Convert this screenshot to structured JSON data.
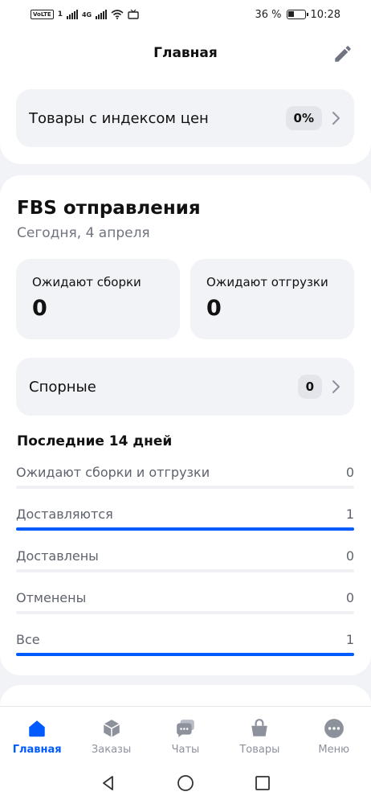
{
  "status_bar": {
    "carrier_badge": "VoLTE",
    "sim_slot": "1",
    "network": "4G",
    "battery_percent": "36 %",
    "time": "10:28"
  },
  "header": {
    "title": "Главная",
    "edit_icon": "pencil-icon",
    "price_index": {
      "label": "Товары с индексом цен",
      "value": "0%"
    }
  },
  "fbs": {
    "title": "FBS отправления",
    "date": "Сегодня, 4 апреля",
    "awaiting_assembly": {
      "label": "Ожидают сборки",
      "value": "0"
    },
    "awaiting_shipment": {
      "label": "Ожидают отгрузки",
      "value": "0"
    },
    "disputed": {
      "label": "Спорные",
      "value": "0"
    },
    "period_title": "Последние 14 дней",
    "period_items": [
      {
        "label": "Ожидают сборки и отгрузки",
        "value": "0",
        "progress": 0
      },
      {
        "label": "Доставляются",
        "value": "1",
        "progress": 1
      },
      {
        "label": "Доставлены",
        "value": "0",
        "progress": 0
      },
      {
        "label": "Отменены",
        "value": "0",
        "progress": 0
      },
      {
        "label": "Все",
        "value": "1",
        "progress": 1
      }
    ]
  },
  "bottom_nav": {
    "items": [
      {
        "label": "Главная",
        "icon": "home-icon",
        "active": true
      },
      {
        "label": "Заказы",
        "icon": "box-icon",
        "active": false
      },
      {
        "label": "Чаты",
        "icon": "chat-icon",
        "active": false
      },
      {
        "label": "Товары",
        "icon": "basket-icon",
        "active": false
      },
      {
        "label": "Меню",
        "icon": "more-icon",
        "active": false
      }
    ]
  },
  "colors": {
    "accent": "#005bff",
    "background": "#f2f3f7",
    "muted_text": "#5f636e"
  }
}
